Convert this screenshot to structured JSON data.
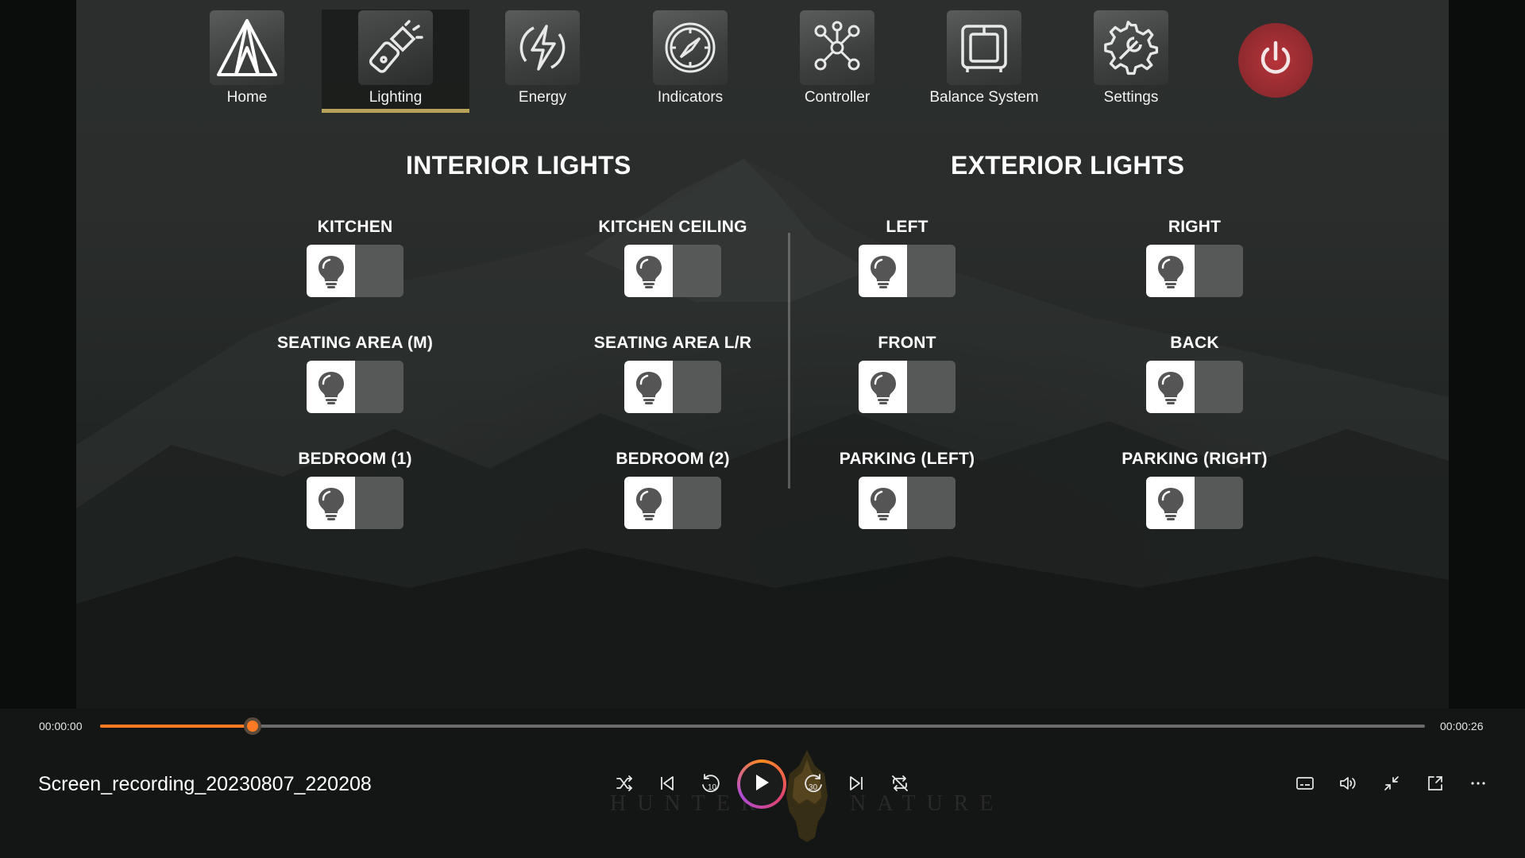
{
  "nav": {
    "items": [
      {
        "label": "Home",
        "icon": "tent-icon"
      },
      {
        "label": "Lighting",
        "icon": "flashlight-icon",
        "active": true
      },
      {
        "label": "Energy",
        "icon": "lightning-icon"
      },
      {
        "label": "Indicators",
        "icon": "compass-icon"
      },
      {
        "label": "Controller",
        "icon": "network-icon"
      },
      {
        "label": "Balance System",
        "icon": "balance-icon"
      },
      {
        "label": "Settings",
        "icon": "gear-wrench-icon"
      }
    ],
    "power_icon": "power-icon",
    "active_color": "#b8a25a",
    "power_color": "#a52f35"
  },
  "interior": {
    "title": "INTERIOR LIGHTS",
    "lights": [
      {
        "label": "KITCHEN",
        "on": false
      },
      {
        "label": "KITCHEN CEILING",
        "on": false
      },
      {
        "label": "SEATING AREA (M)",
        "on": false
      },
      {
        "label": "SEATING AREA L/R",
        "on": false
      },
      {
        "label": "BEDROOM (1)",
        "on": false
      },
      {
        "label": "BEDROOM (2)",
        "on": false
      }
    ]
  },
  "exterior": {
    "title": "EXTERIOR LIGHTS",
    "lights": [
      {
        "label": "LEFT",
        "on": false
      },
      {
        "label": "RIGHT",
        "on": false
      },
      {
        "label": "FRONT",
        "on": false
      },
      {
        "label": "BACK",
        "on": false
      },
      {
        "label": "PARKING (LEFT)",
        "on": false
      },
      {
        "label": "PARKING (RIGHT)",
        "on": false
      }
    ]
  },
  "player": {
    "current_time": "00:00:00",
    "total_time": "00:00:26",
    "progress": 0.115,
    "file_title": "Screen_recording_20230807_220208",
    "controls": [
      "shuffle-icon",
      "previous-icon",
      "rewind-10-icon",
      "play-icon",
      "forward-30-icon",
      "next-icon",
      "repeat-off-icon"
    ],
    "right_controls": [
      "subtitles-icon",
      "volume-icon",
      "exit-fullscreen-icon",
      "mini-player-icon",
      "more-icon"
    ],
    "accent_color": "#ff7a22",
    "watermark_left": "HUNTER",
    "watermark_right": "NATURE"
  }
}
